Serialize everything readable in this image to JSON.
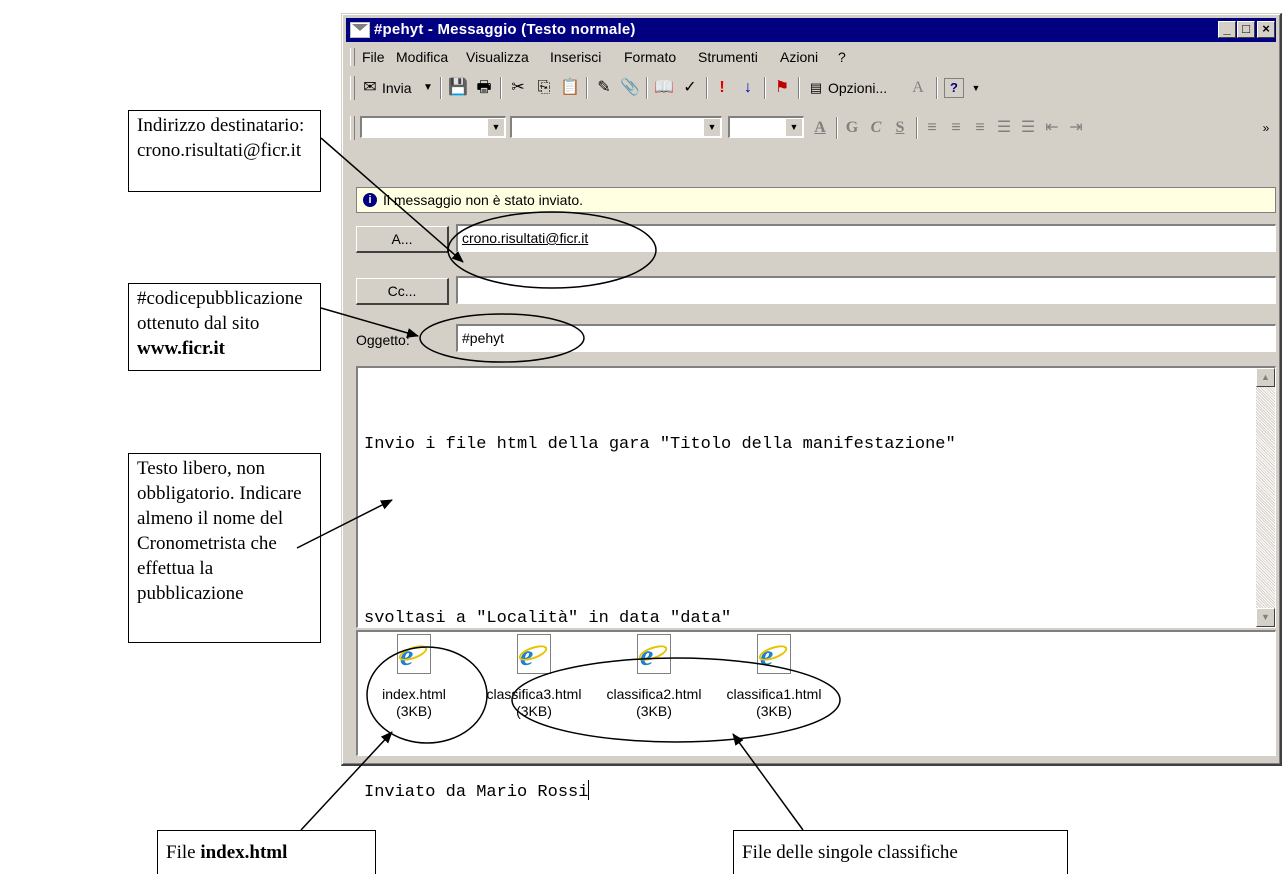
{
  "window": {
    "title": "#pehyt - Messaggio (Testo normale)",
    "controls": {
      "minimize": "_",
      "maximize": "□",
      "close": "×"
    }
  },
  "menu": [
    "File",
    "Modifica",
    "Visualizza",
    "Inserisci",
    "Formato",
    "Strumenti",
    "Azioni",
    "?"
  ],
  "toolbar": {
    "send_label": "Invia",
    "options_label": "Opzioni...",
    "bold": "G",
    "italic": "C",
    "underline": "S"
  },
  "infobar": {
    "text": "Il messaggio non è stato inviato."
  },
  "header": {
    "to_button": "A...",
    "to_value": "crono.risultati@ficr.it",
    "cc_button": "Cc...",
    "cc_value": "",
    "subject_label": "Oggetto:",
    "subject_value": "#pehyt"
  },
  "body": {
    "lines": [
      "Invio i file html della gara \"Titolo della manifestazione\"",
      "",
      "svoltasi a \"Località\" in data \"data\"",
      "",
      "Inviato da Mario Rossi"
    ]
  },
  "attachments": [
    {
      "name": "index.html",
      "size": "(3KB)"
    },
    {
      "name": "classifica3.html",
      "size": "(3KB)"
    },
    {
      "name": "classifica2.html",
      "size": "(3KB)"
    },
    {
      "name": "classifica1.html",
      "size": "(3KB)"
    }
  ],
  "annotations": {
    "recipient": {
      "line1": "Indirizzo destinatario:",
      "line2": "crono.risultati@ficr.it"
    },
    "code": {
      "line1": "#codicepubblicazione",
      "line2": "ottenuto dal sito",
      "line3": "www.ficr.it"
    },
    "freetext": {
      "line1": "Testo libero, non",
      "line2": "obbligatorio. Indicare",
      "line3": "almeno il nome del",
      "line4": "Cronometrista che",
      "line5": "effettua la pubblicazione"
    },
    "index": {
      "prefix": "File ",
      "bold": "index.html"
    },
    "classifiche": {
      "text": "File delle singole classifiche"
    }
  },
  "colors": {
    "titlebar": "#000080",
    "chrome": "#d4d0c8",
    "infobar": "#ffffe1",
    "ie_blue": "#1e7fd6"
  }
}
